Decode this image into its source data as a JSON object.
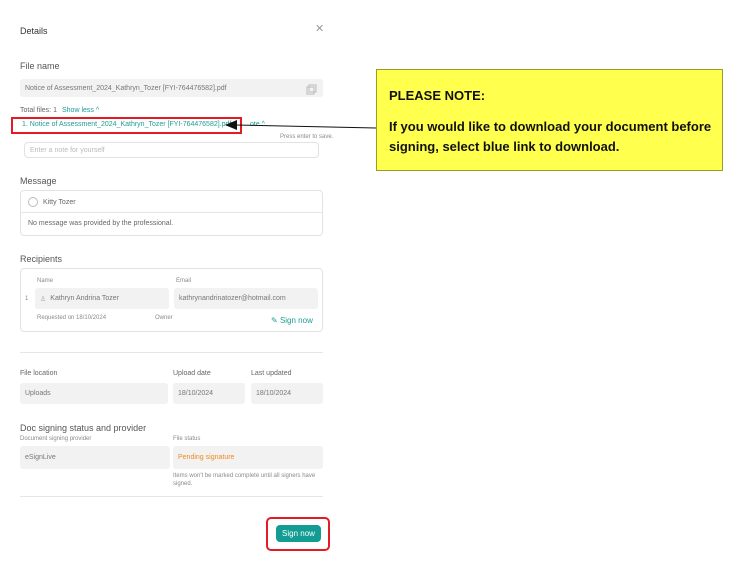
{
  "panel": {
    "title": "Details",
    "file_name_label": "File name",
    "file_name_value": "Notice of Assessment_2024_Kathryn_Tozer [FYI-764476582].pdf",
    "total_files": "Total files: 1",
    "show_less": "Show less ^",
    "file_link": "1. Notice of Assessment_2024_Kathryn_Tozer [FYI-764476582].pdf",
    "note_hidden": "ote ^",
    "press_enter": "Press enter to save.",
    "note_placeholder": "Enter a note for yourself",
    "message_label": "Message",
    "message_sender": "Kitty Tozer",
    "message_text": "No message was provided by the professional.",
    "recipients_label": "Recipients",
    "name_col": "Name",
    "email_col": "Email",
    "recipient_index": "1",
    "recipient_name": "Kathryn Andrina Tozer",
    "recipient_email": "kathrynandrinatozer@hotmail.com",
    "requested_on": "Requested on 18/10/2024",
    "owner": "Owner",
    "sign_now_link": "Sign now",
    "file_location_label": "File location",
    "file_location_value": "Uploads",
    "upload_date_label": "Upload date",
    "upload_date_value": "18/10/2024",
    "last_updated_label": "Last updated",
    "last_updated_value": "18/10/2024",
    "doc_signing_label": "Doc signing status and provider",
    "provider_label": "Document signing provider",
    "provider_value": "eSignLive",
    "file_status_label": "File status",
    "file_status_value": "Pending signature",
    "status_help": "Items won't be marked complete until all signers have signed.",
    "sign_now_button": "Sign now",
    "status_color": "#f08a1c",
    "accent_color": "#129c94"
  },
  "note": {
    "title": "PLEASE NOTE:",
    "body": "If you would like to download your document before signing, select blue link to download."
  }
}
